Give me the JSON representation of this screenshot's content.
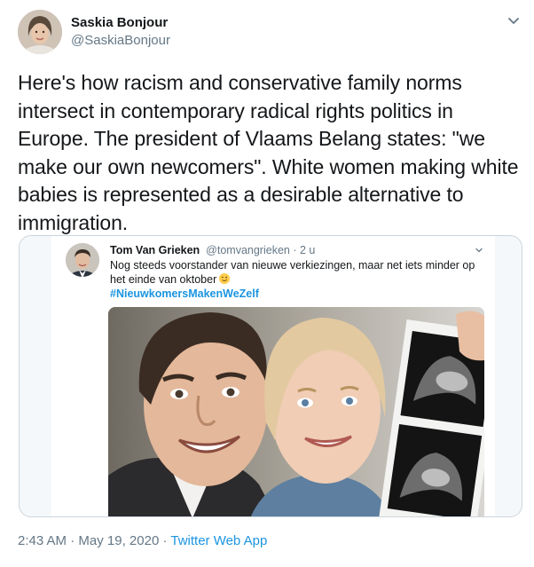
{
  "author": {
    "name": "Saskia Bonjour",
    "handle": "@SaskiaBonjour"
  },
  "tweet": {
    "text": "Here's how racism and conservative family norms intersect in contemporary radical rights politics in Europe. The president of Vlaams Belang states: \"we make our own newcomers\". White women making white babies is represented as a desirable alternative to immigration."
  },
  "embedded": {
    "name": "Tom Van Grieken",
    "handle": "@tomvangrieken",
    "separator": " · ",
    "time": "2 u",
    "text": "Nog steeds voorstander van nieuwe verkiezingen, maar net iets minder op het einde van oktober",
    "emoji": "winking-face",
    "hashtag": "#NieuwkomersMakenWeZelf"
  },
  "footer": {
    "time": "2:43 AM",
    "separator": " · ",
    "date": "May 19, 2020",
    "source": "Twitter Web App"
  },
  "colors": {
    "link": "#1b95e0",
    "muted": "#657786",
    "text": "#14171a",
    "border": "#ccd6dd"
  },
  "icons": [
    "chevron-down-icon",
    "winking-face-emoji"
  ]
}
